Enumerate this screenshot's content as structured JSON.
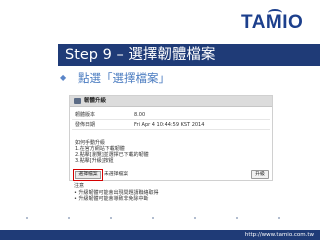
{
  "logo": {
    "text": "TAMIO"
  },
  "slide": {
    "title": "Step 9 – 選擇韌體檔案",
    "bullet": "點選「選擇檔案」"
  },
  "panel": {
    "title": "韌體升級",
    "rows": [
      {
        "label": "韌體版本",
        "value": "8.00"
      },
      {
        "label": "發佈日期",
        "value": "Fri Apr 4 10:44:59 KST 2014"
      }
    ],
    "instructions": [
      "如何手動升級",
      "1.在官方網站下載韌體",
      "2.點擊[瀏覽]並選擇已下載的韌體",
      "3.點擊[升級]按鈕"
    ],
    "choose_file_label": "選擇檔案",
    "no_file_text": "未選擇檔案",
    "upgrade_label": "升級"
  },
  "notes": {
    "heading": "注意",
    "items": [
      "• 升級韌體可能會出現問題請聯絡取得",
      "• 升級韌體可能會導致非免除中斷"
    ]
  },
  "footer": {
    "url": "http://www.tamio.com.tw"
  },
  "colors": {
    "brand_navy": "#1f3b77",
    "bullet_blue": "#4a7bc0",
    "highlight_red": "#d40000"
  }
}
